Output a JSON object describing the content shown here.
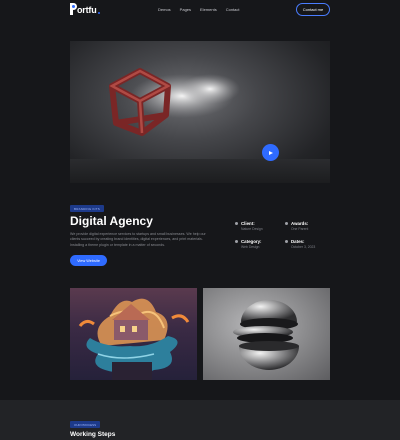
{
  "brand": {
    "name": "ortfu",
    "accent": "#2f6bff"
  },
  "nav": {
    "items": [
      "Demos",
      "Pages",
      "Elements",
      "Contact"
    ],
    "cta": "Contact me"
  },
  "project": {
    "badge": "BRANDING KITS",
    "title": "Digital Agency",
    "description": "We provide digital experience services to startups and small businesses. We help our clients succeed by creating brand identities, digital experiences, and print materials. Installing a theme plugin or template in a matter of seconds.",
    "button": "View Website",
    "meta": [
      {
        "label": "Client:",
        "value": "Nature Design"
      },
      {
        "label": "Awards:",
        "value": "One Parent"
      },
      {
        "label": "Category:",
        "value": "Web Design"
      },
      {
        "label": "Dates:",
        "value": "October 3, 2023"
      }
    ]
  },
  "section": {
    "badge": "OUR PROCESS",
    "title": "Working Steps"
  },
  "icons": {
    "play": "play-icon",
    "meta": "bullet-icon"
  }
}
